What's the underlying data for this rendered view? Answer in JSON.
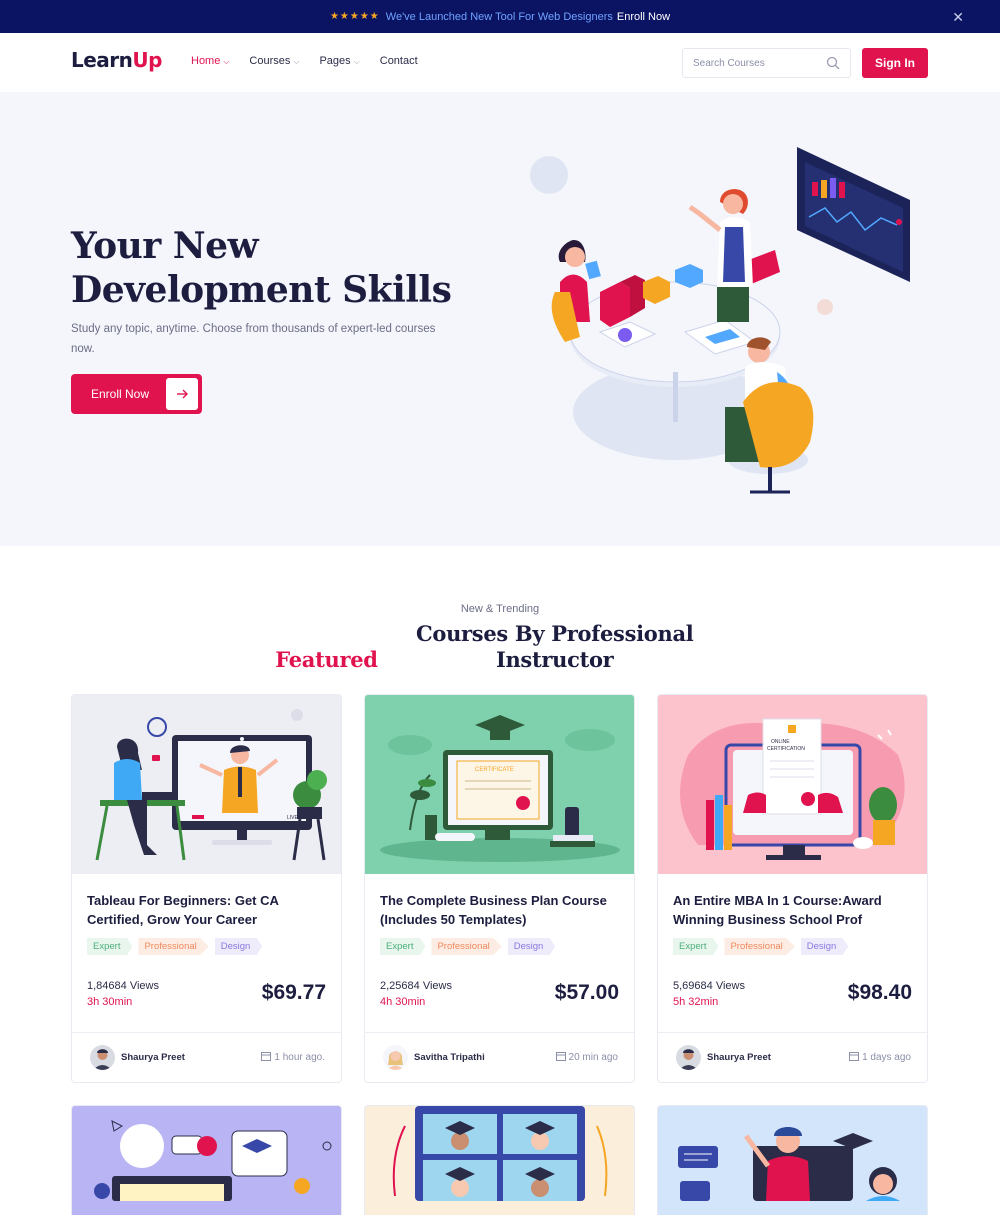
{
  "announcement": {
    "stars": "★★★★★",
    "message": "We've Launched New Tool For Web Designers",
    "cta": "Enroll Now",
    "close": "✕"
  },
  "brand": {
    "part1": "Learn",
    "part2": "Up"
  },
  "nav": {
    "items": [
      {
        "label": "Home",
        "has_dropdown": true,
        "active": true
      },
      {
        "label": "Courses",
        "has_dropdown": true
      },
      {
        "label": "Pages",
        "has_dropdown": true
      },
      {
        "label": "Contact",
        "has_dropdown": false
      }
    ],
    "search_placeholder": "Search Courses",
    "signin_label": "Sign In"
  },
  "hero": {
    "title_line1": "Your New",
    "title_line2": "Development Skills",
    "subtitle": "Study any topic, anytime. Choose from thousands of expert-led courses now.",
    "button_label": "Enroll Now"
  },
  "featured": {
    "kicker": "New & Trending",
    "title_highlight": "Featured",
    "title_rest": "Courses By Professional Instructor"
  },
  "courses": [
    {
      "title": "Tableau For Beginners: Get CA Certified, Grow Your Career",
      "tags": [
        "Expert",
        "Professional",
        "Design"
      ],
      "views": "1,84684 Views",
      "duration": "3h 30min",
      "price": "$69.77",
      "author": "Shaurya Preet",
      "posted": "1 hour ago."
    },
    {
      "title": "The Complete Business Plan Course (Includes 50 Templates)",
      "tags": [
        "Expert",
        "Professional",
        "Design"
      ],
      "views": "2,25684 Views",
      "duration": "4h 30min",
      "price": "$57.00",
      "author": "Savitha Tripathi",
      "posted": "20 min ago"
    },
    {
      "title": "An Entire MBA In 1 Course:Award Winning Business School Prof",
      "tags": [
        "Expert",
        "Professional",
        "Design"
      ],
      "views": "5,69684 Views",
      "duration": "5h 32min",
      "price": "$98.40",
      "author": "Shaurya Preet",
      "posted": "1 days ago"
    }
  ],
  "colors": {
    "brand_red": "#e0134f",
    "navy": "#0b1463",
    "hero_bg": "#f4f6fb"
  }
}
